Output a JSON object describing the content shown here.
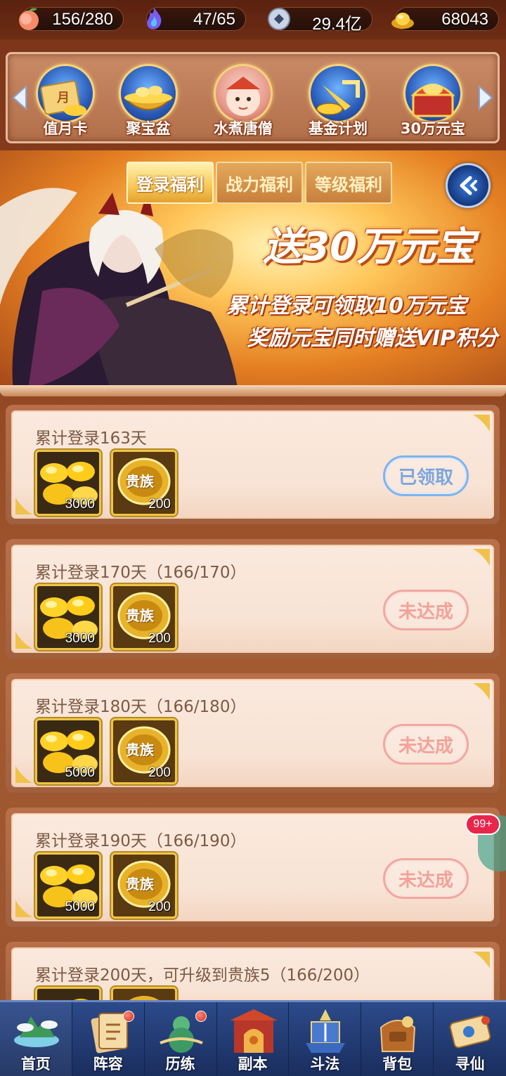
{
  "resources": [
    {
      "icon": "peach-icon",
      "value": "156/280"
    },
    {
      "icon": "spirit-flame-icon",
      "value": "47/65"
    },
    {
      "icon": "coin-icon",
      "value": "29.4亿"
    },
    {
      "icon": "gold-ingot-icon",
      "value": "68043"
    }
  ],
  "carousel": {
    "items": [
      {
        "label": "值月卡",
        "inner_text": "月"
      },
      {
        "label": "聚宝盆"
      },
      {
        "label": "水煮唐僧"
      },
      {
        "label": "基金计划"
      },
      {
        "label": "30万元宝"
      }
    ]
  },
  "banner": {
    "tabs": [
      "登录福利",
      "战力福利",
      "等级福利"
    ],
    "active_tab": 0,
    "headline": "送30万元宝",
    "line1": "累计登录可领取10万元宝",
    "line2": "奖励元宝同时赠送VIP积分"
  },
  "rewards": [
    {
      "title": "累计登录163天",
      "items": [
        {
          "type": "gold",
          "count": "3000"
        },
        {
          "type": "noble",
          "label": "贵族",
          "count": "200"
        }
      ],
      "status": "已领取",
      "state": "claimed"
    },
    {
      "title": "累计登录170天（166/170）",
      "items": [
        {
          "type": "gold",
          "count": "3000"
        },
        {
          "type": "noble",
          "label": "贵族",
          "count": "200"
        }
      ],
      "status": "未达成",
      "state": "pending"
    },
    {
      "title": "累计登录180天（166/180）",
      "items": [
        {
          "type": "gold",
          "count": "5000"
        },
        {
          "type": "noble",
          "label": "贵族",
          "count": "200"
        }
      ],
      "status": "未达成",
      "state": "pending"
    },
    {
      "title": "累计登录190天（166/190）",
      "items": [
        {
          "type": "gold",
          "count": "5000"
        },
        {
          "type": "noble",
          "label": "贵族",
          "count": "200"
        }
      ],
      "status": "未达成",
      "state": "pending"
    },
    {
      "title": "累计登录200天，可升级到贵族5（166/200）",
      "items": [],
      "status": "",
      "state": "pending"
    }
  ],
  "notification_badge": "99+",
  "nav": {
    "items": [
      "首页",
      "阵容",
      "历练",
      "副本",
      "斗法",
      "背包",
      "寻仙"
    ]
  }
}
